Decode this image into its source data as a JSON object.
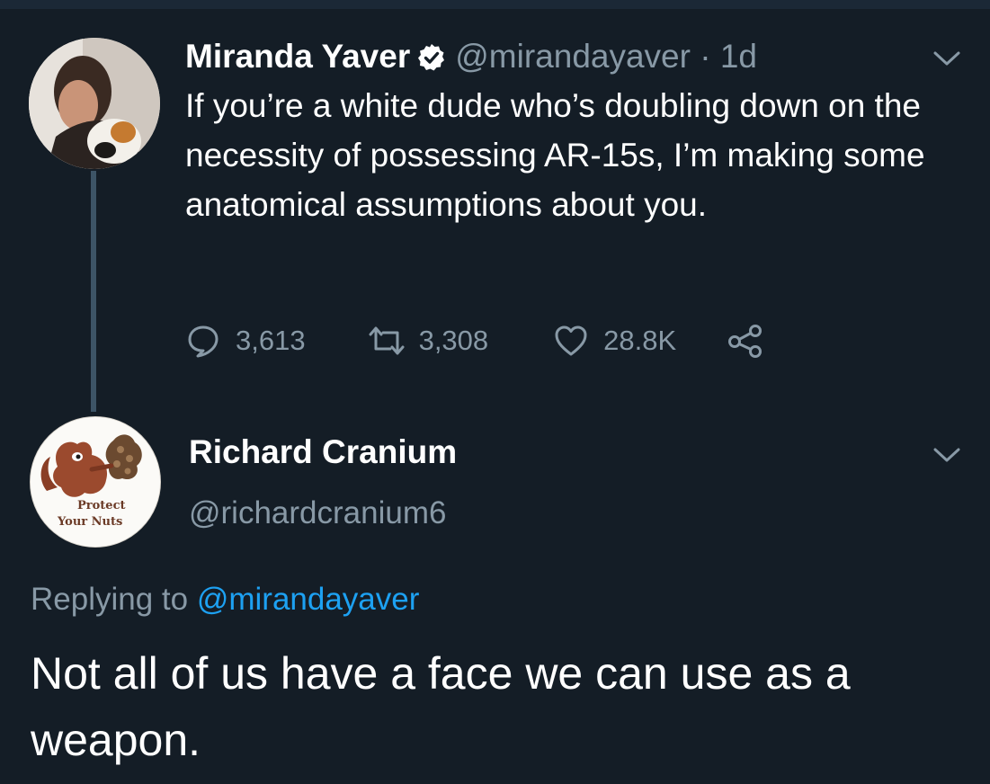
{
  "original_tweet": {
    "display_name": "Miranda Yaver",
    "handle": "@mirandayaver",
    "separator": " · ",
    "time": "1d",
    "text": "If you’re a white dude who’s doubling down on the necessity of possessing AR-15s, I’m making some anatomical assumptions about you.",
    "replies_count": "3,613",
    "retweets_count": "3,308",
    "likes_count": "28.8K"
  },
  "reply_tweet": {
    "display_name": "Richard Cranium",
    "handle": "@richardcranium6",
    "avatar_caption_line1": "Protect",
    "avatar_caption_line2": "Your Nuts",
    "replying_to_prefix": "Replying to ",
    "replying_to_handle": "@mirandayaver",
    "text": "Not all of us have a face we can use as a weapon."
  },
  "icons": {
    "verified": "verified-badge-icon",
    "menu": "chevron-down-icon",
    "reply": "reply-bubble-icon",
    "retweet": "retweet-icon",
    "like": "heart-icon",
    "share": "share-icon"
  },
  "colors": {
    "background": "#141d26",
    "secondary_text": "#8899a6",
    "link": "#1da1f2",
    "thread_line": "#3d5466"
  }
}
